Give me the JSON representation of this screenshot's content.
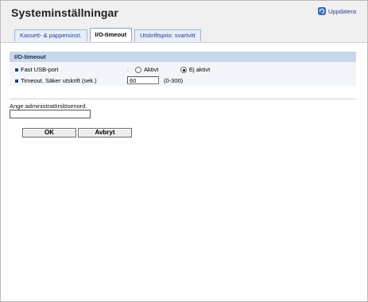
{
  "page": {
    "title": "Systeminställningar",
    "refresh_label": "Uppdatera"
  },
  "tabs": [
    {
      "label": "Kassett- & pappersinst."
    },
    {
      "label": "I/O-timeout"
    },
    {
      "label": "Utskriftsprio: svartvitt"
    }
  ],
  "section": {
    "title": "I/O-timeout",
    "usb": {
      "label": "Fast USB-port",
      "colon": ":",
      "option_on": "Aktivt",
      "option_off": "Ej aktivt",
      "selected": "Ej aktivt"
    },
    "timeout": {
      "label": "Timeout, Säker utskrift (sek.)",
      "colon": ":",
      "value": "60",
      "range": "(0-300)"
    }
  },
  "admin": {
    "password_label": "Ange administratörslösenord.",
    "password_value": ""
  },
  "buttons": {
    "ok": "OK",
    "cancel": "Avbryt"
  },
  "colors": {
    "accent": "#1f3f96",
    "section_header": "#c8d7ea",
    "section_body": "#f2f6fb"
  }
}
